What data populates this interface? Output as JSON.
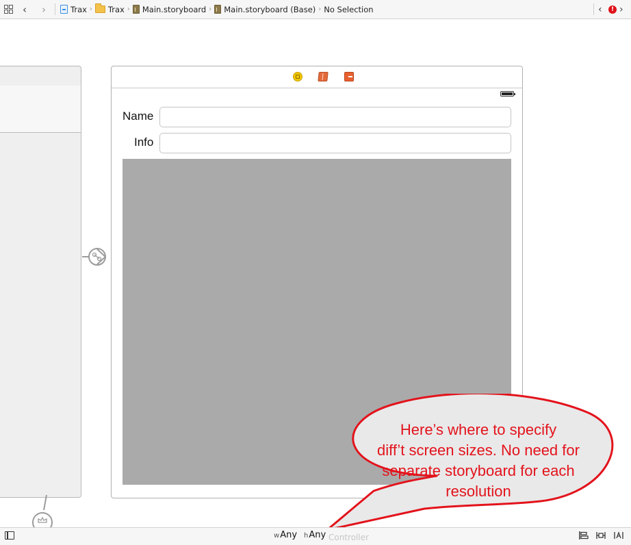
{
  "jumpbar": {
    "crumbs": [
      {
        "label": "Trax",
        "icon": "project-file-icon"
      },
      {
        "label": "Trax",
        "icon": "folder-icon"
      },
      {
        "label": "Main.storyboard",
        "icon": "storyboard-file-icon"
      },
      {
        "label": "Main.storyboard (Base)",
        "icon": "storyboard-file-icon"
      },
      {
        "label": "No Selection"
      }
    ],
    "issue_badge": "!"
  },
  "scene": {
    "name_label": "Name",
    "info_label": "Info",
    "name_value": "",
    "info_value": "",
    "image_color": "#aaaaaa"
  },
  "callout": {
    "lines": [
      "Here’s where to specify",
      "diff’t screen sizes. No need for",
      "separate storyboard for each",
      "resolution"
    ],
    "text_color": "#e3131c",
    "border_color": "#e3131c"
  },
  "bottombar": {
    "width_prefix": "w",
    "width_value": "Any",
    "height_prefix": "h",
    "height_value": "Any",
    "hidden_label": "Controller"
  }
}
